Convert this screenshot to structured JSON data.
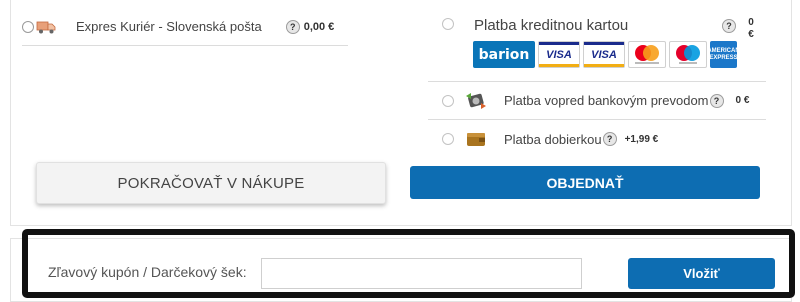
{
  "shipping": {
    "option_label": "Expres Kuriér - Slovenská pošta",
    "price": "0,00 €",
    "help_glyph": "?",
    "icon": "truck-icon"
  },
  "payment": {
    "card": {
      "label": "Platba kreditnou kartou",
      "price_top": "0",
      "price_bottom": "€",
      "help_glyph": "?",
      "logos": {
        "barion": "barion",
        "visa1": "VISA",
        "visa2": "VISA",
        "amex": "AMERICAN EXPRESS"
      }
    },
    "bank": {
      "label": "Platba vopred bankovým prevodom",
      "price": "0 €",
      "help_glyph": "?",
      "icon": "bank-transfer-icon"
    },
    "cod": {
      "label": "Platba dobierkou",
      "price": "+1,99 €",
      "help_glyph": "?",
      "icon": "wallet-icon"
    }
  },
  "actions": {
    "continue_label": "POKRAČOVAŤ V NÁKUPE",
    "order_label": "OBJEDNAŤ"
  },
  "coupon": {
    "label": "Zľavový kupón / Darčekový šek:",
    "value": "",
    "apply_label": "Vložiť"
  },
  "colors": {
    "accent": "#0d6db2",
    "highlight_frame": "#111111"
  }
}
